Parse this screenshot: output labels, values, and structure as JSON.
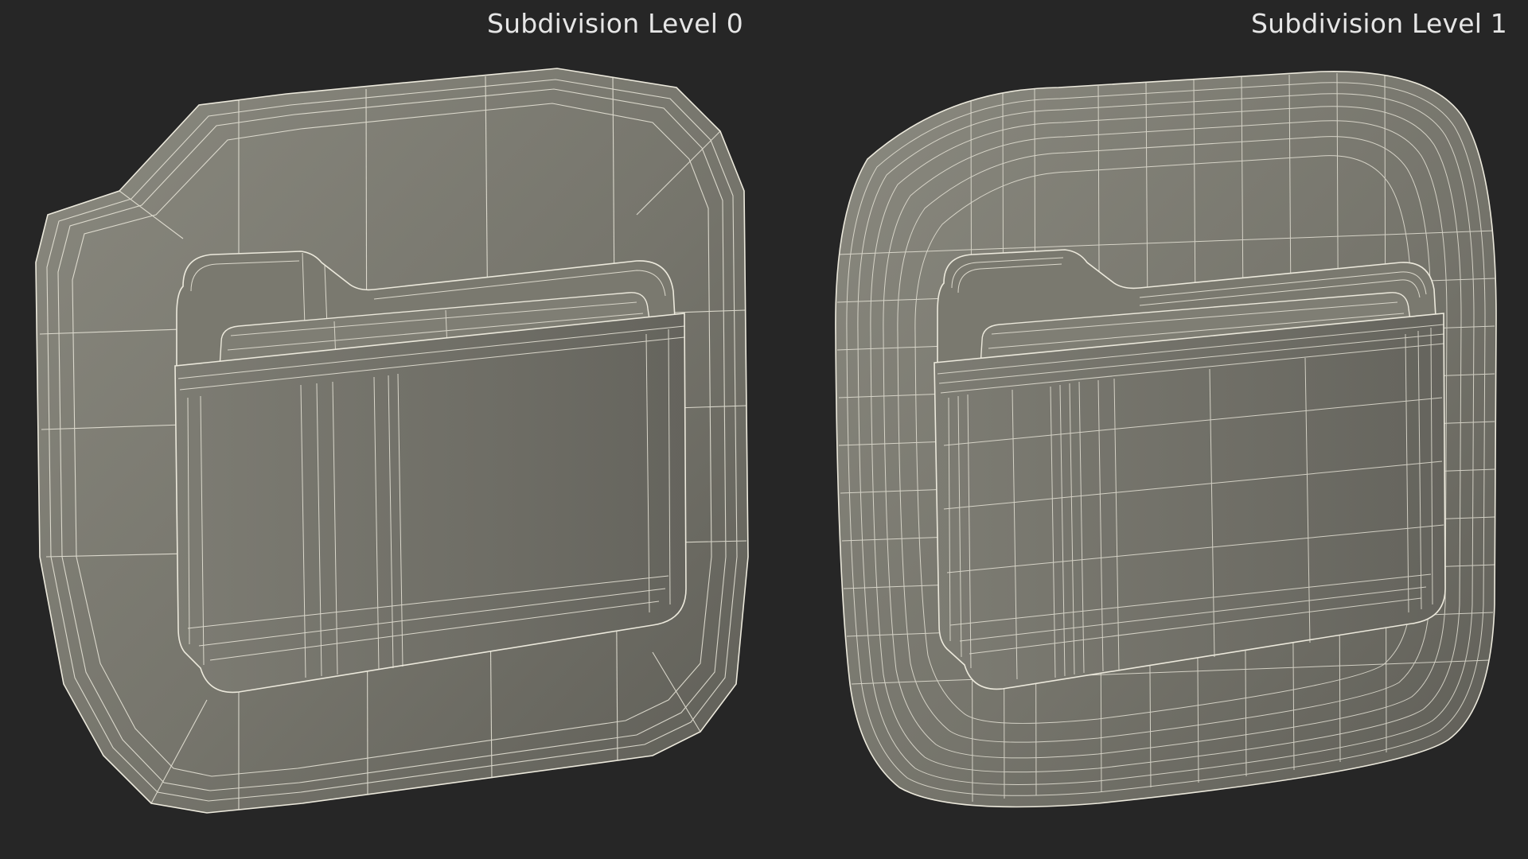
{
  "captions": {
    "left": "Subdivision Level 0",
    "right": "Subdivision Level 1"
  },
  "colors": {
    "background": "#262626",
    "mesh_fill_light": "#8a897f",
    "mesh_fill_dark": "#5f5e57",
    "wire": "#ece9dc",
    "caption_text": "#e6e6e6"
  },
  "models": [
    {
      "name": "subdivision-level-0",
      "subdivision_level": 0
    },
    {
      "name": "subdivision-level-1",
      "subdivision_level": 1
    }
  ]
}
